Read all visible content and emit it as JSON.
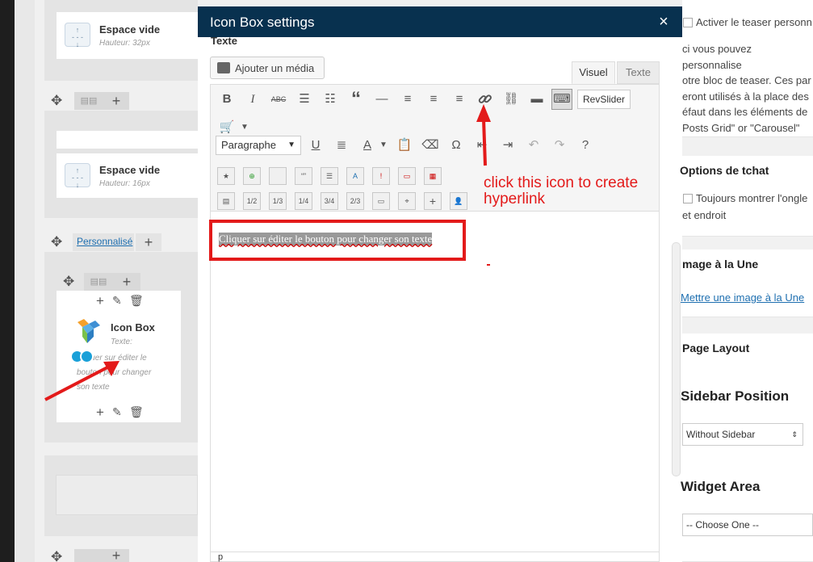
{
  "builder": {
    "spacer1": {
      "title": "Espace vide",
      "subtitle": "Hauteur: 32px"
    },
    "spacer2": {
      "title": "Espace vide",
      "subtitle": "Hauteur: 16px"
    },
    "custom_tab": "Personnalisé",
    "iconbox": {
      "title": "Icon Box",
      "sub_label": "Texte:",
      "text": "Cliquer sur éditer le bouton pour changer son texte"
    }
  },
  "modal": {
    "title": "Icon Box settings",
    "close": "×",
    "field_label": "Texte",
    "add_media": "Ajouter un média",
    "tabs": [
      "Visuel",
      "Texte"
    ],
    "revslider": "RevSlider",
    "paragraph_format": "Paragraphe",
    "content": "Cliquer sur éditer le bouton pour changer son texte",
    "status": "p"
  },
  "annotation": {
    "line1": "click this icon to create",
    "line2": "hyperlink"
  },
  "right": {
    "teaser_label": "Activer le teaser personn",
    "teaser_desc": [
      "ci vous pouvez personnalise",
      "otre bloc de teaser. Ces par",
      "eront utilisés à la place des",
      "éfaut dans les éléments de",
      "Posts Grid\" or \"Carousel\""
    ],
    "chat_title": "Options de tchat",
    "chat_label": "Toujours montrer l'ongle",
    "chat_label2": "et endroit",
    "featured_title": "mage à la Une",
    "featured_link": "Mettre une image à la Une",
    "layout_title": "Page Layout",
    "sidebar_title": "Sidebar Position",
    "sidebar_value": "Without Sidebar",
    "widget_title": "Widget Area",
    "widget_value": "-- Choose One --"
  },
  "colors": {
    "modal_header": "#08314f",
    "annotation": "#e31a1a",
    "link": "#1e6fb0"
  }
}
